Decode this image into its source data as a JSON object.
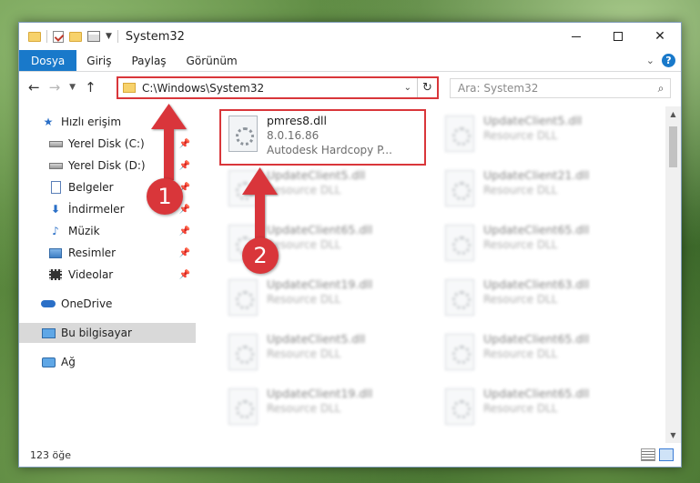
{
  "window": {
    "title": "System32",
    "controls": {
      "minimize": "minimize",
      "maximize": "maximize",
      "close": "✕"
    }
  },
  "ribbon": {
    "tabs": [
      {
        "label": "Dosya",
        "active": true
      },
      {
        "label": "Giriş"
      },
      {
        "label": "Paylaş"
      },
      {
        "label": "Görünüm"
      }
    ]
  },
  "address": {
    "path": "C:\\Windows\\System32",
    "search_placeholder": "Ara: System32"
  },
  "sidebar": {
    "items": [
      {
        "label": "Hızlı erişim",
        "icon": "star-icon"
      },
      {
        "label": "Yerel Disk (C:)",
        "icon": "disk-icon",
        "pinned": true
      },
      {
        "label": "Yerel Disk (D:)",
        "icon": "disk-icon",
        "pinned": true
      },
      {
        "label": "Belgeler",
        "icon": "document-icon",
        "pinned": true
      },
      {
        "label": "İndirmeler",
        "icon": "download-icon",
        "pinned": true
      },
      {
        "label": "Müzik",
        "icon": "music-icon",
        "pinned": true
      },
      {
        "label": "Resimler",
        "icon": "pictures-icon",
        "pinned": true
      },
      {
        "label": "Videolar",
        "icon": "video-icon",
        "pinned": true
      },
      {
        "label": "OneDrive",
        "icon": "cloud-icon"
      },
      {
        "label": "Bu bilgisayar",
        "icon": "computer-icon",
        "selected": true
      },
      {
        "label": "Ağ",
        "icon": "network-icon"
      }
    ]
  },
  "files": {
    "featured": {
      "name": "pmres8.dll",
      "version": "8.0.16.86",
      "description": "Autodesk Hardcopy P..."
    },
    "left_column": [
      {
        "name": "UpdateClient5.dll",
        "type": "Resource DLL"
      },
      {
        "name": "UpdateClient65.dll",
        "type": "Resource DLL"
      },
      {
        "name": "UpdateClient19.dll",
        "type": "Resource DLL"
      },
      {
        "name": "UpdateClient5.dll",
        "type": "Resource DLL"
      },
      {
        "name": "UpdateClient19.dll",
        "type": "Resource DLL"
      }
    ],
    "right_column": [
      {
        "name": "UpdateClient5.dll",
        "type": "Resource DLL"
      },
      {
        "name": "UpdateClient21.dll",
        "type": "Resource DLL"
      },
      {
        "name": "UpdateClient65.dll",
        "type": "Resource DLL"
      },
      {
        "name": "UpdateClient63.dll",
        "type": "Resource DLL"
      },
      {
        "name": "UpdateClient65.dll",
        "type": "Resource DLL"
      },
      {
        "name": "UpdateClient65.dll",
        "type": "Resource DLL"
      }
    ]
  },
  "status": {
    "item_count": "123 öğe"
  },
  "annotations": {
    "step1": "1",
    "step2": "2",
    "color": "#d9363a"
  }
}
